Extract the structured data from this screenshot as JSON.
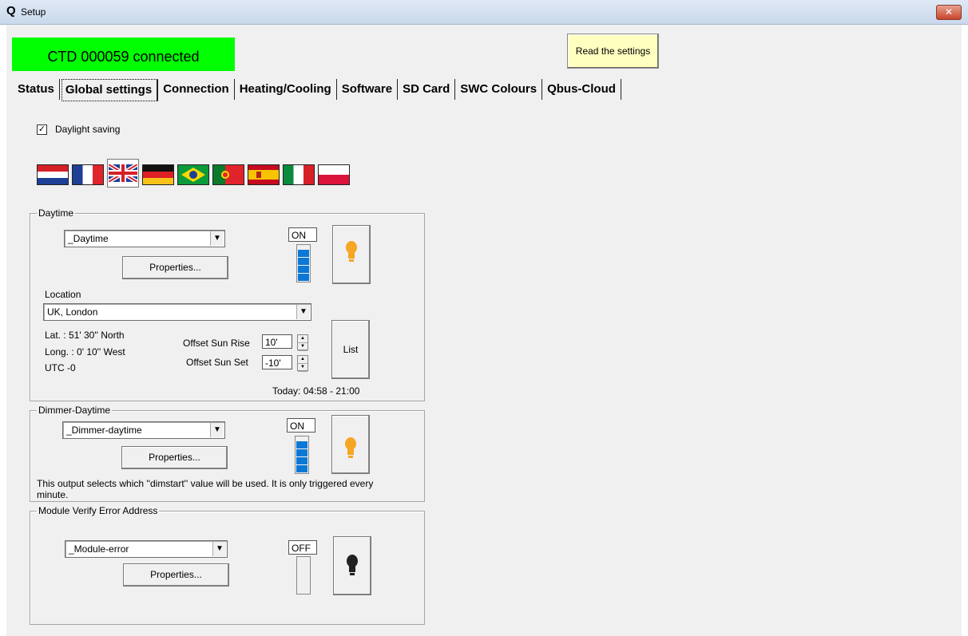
{
  "window": {
    "title": "Setup",
    "close_label": "✕"
  },
  "header": {
    "connection_status": "CTD 000059 connected",
    "read_button": "Read the settings"
  },
  "tabs": [
    {
      "label": "Status"
    },
    {
      "label": "Global settings",
      "active": true
    },
    {
      "label": "Connection"
    },
    {
      "label": "Heating/Cooling"
    },
    {
      "label": "Software"
    },
    {
      "label": "SD Card"
    },
    {
      "label": "SWC Colours"
    },
    {
      "label": "Qbus-Cloud"
    }
  ],
  "daylight_saving": {
    "label": "Daylight saving",
    "checked": true
  },
  "flags": [
    "nl",
    "fr",
    "uk",
    "de",
    "br",
    "pt",
    "es",
    "it",
    "pl"
  ],
  "daytime": {
    "legend": "Daytime",
    "selected": "_Daytime",
    "properties": "Properties...",
    "state": "ON",
    "level": 1.0,
    "location_label": "Location",
    "location": "UK, London",
    "lat": "Lat.   : 51' 30'' North",
    "long": "Long. : 0' 10'' West",
    "utc": "UTC -0",
    "offset_sunrise_label": "Offset Sun Rise",
    "offset_sunrise": "10'",
    "offset_sunset_label": "Offset Sun Set",
    "offset_sunset": "-10'",
    "list": "List",
    "today": "Today: 04:58 - 21:00"
  },
  "dimmer_daytime": {
    "legend": "Dimmer-Daytime",
    "selected": "_Dimmer-daytime",
    "properties": "Properties...",
    "state": "ON",
    "level": 1.0,
    "note": "This output selects which ''dimstart'' value will be used. It is only triggered every",
    "note2": "minute."
  },
  "module_error": {
    "legend": "Module Verify Error Address",
    "selected": "_Module-error",
    "properties": "Properties...",
    "state": "OFF",
    "level": 0
  },
  "colors": {
    "connected": "#00ff00",
    "bulb_on": "#f5a623",
    "bulb_off": "#222222",
    "level_fill": "#0a78d6"
  }
}
